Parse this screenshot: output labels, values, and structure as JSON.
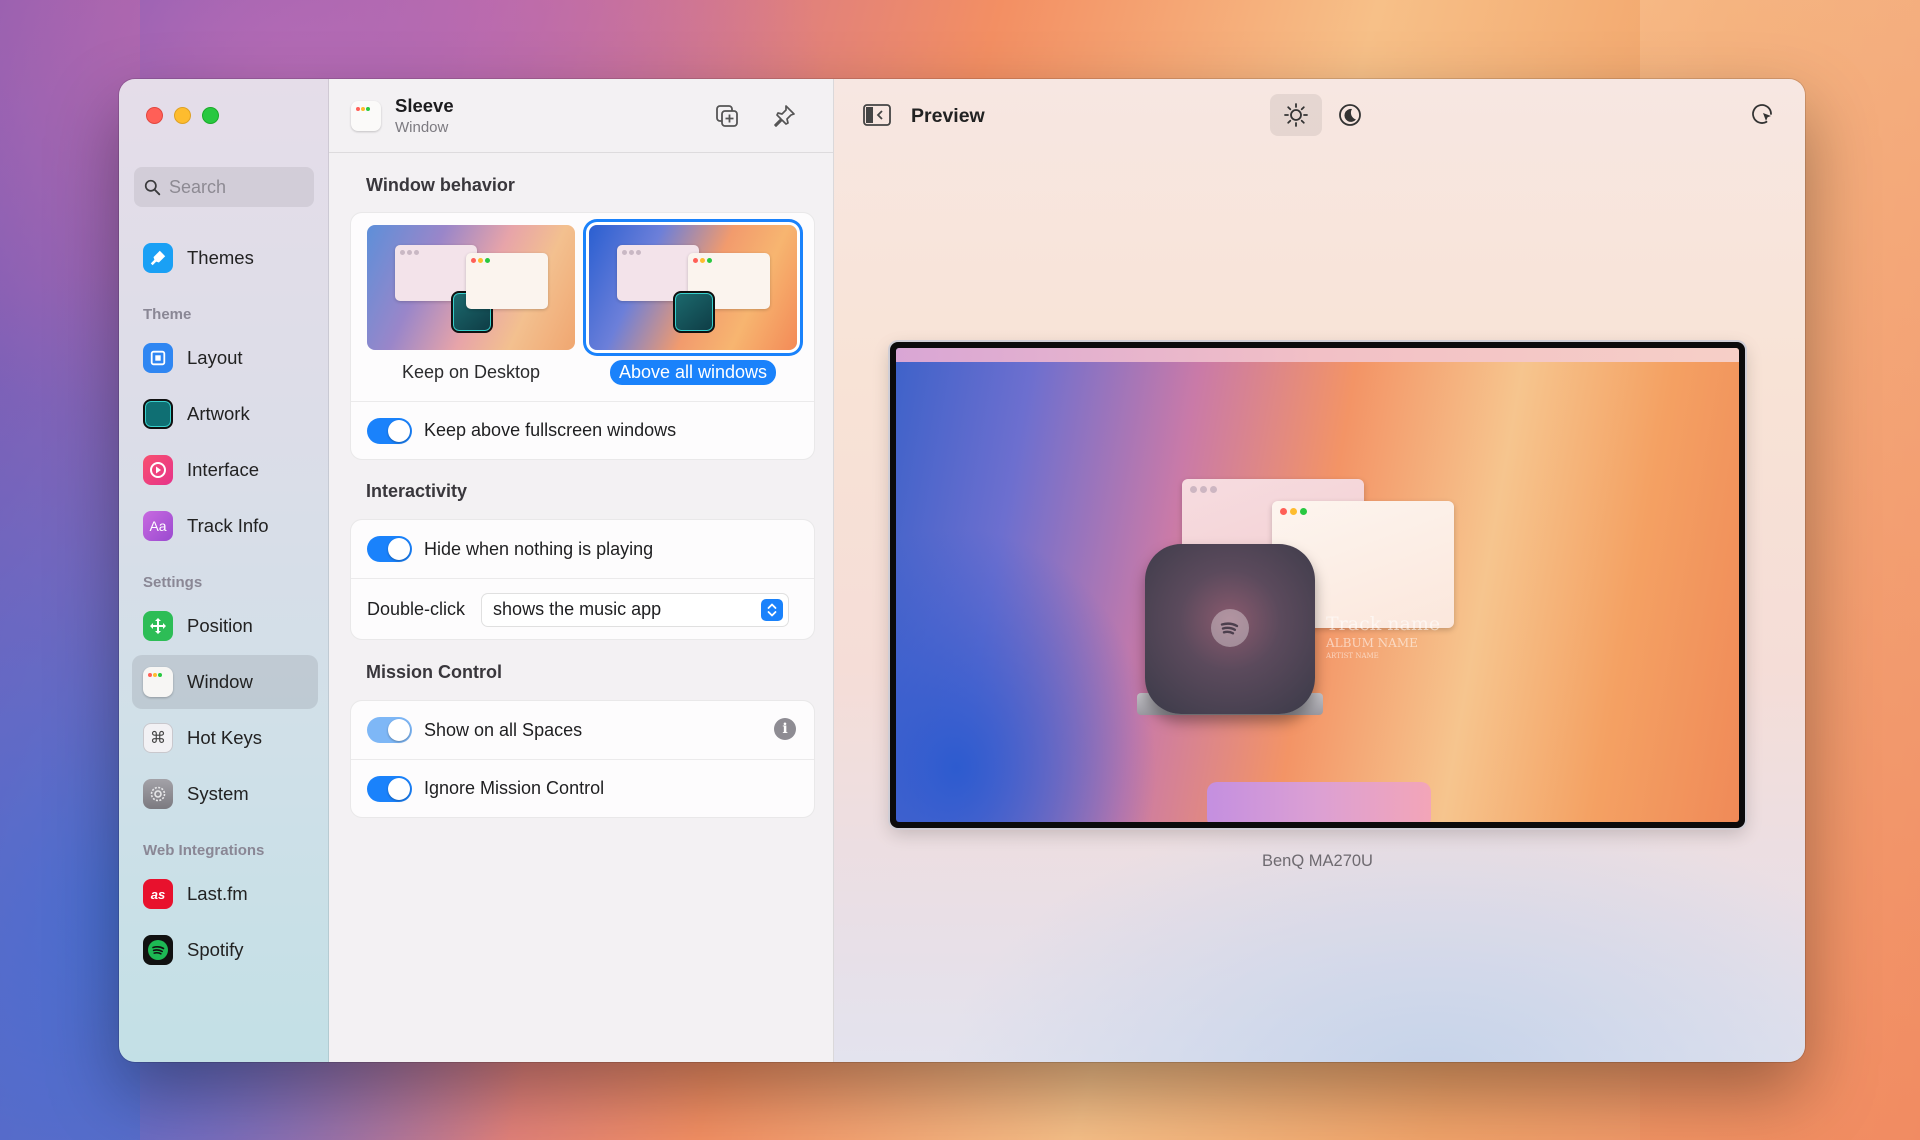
{
  "window": {
    "traffic_lights": {
      "close": "#ff5f57",
      "minimize": "#febc2e",
      "zoom": "#28c840"
    }
  },
  "sidebar": {
    "search_placeholder": "Search",
    "items": [
      {
        "label": "Themes",
        "icon": "themes-icon",
        "color": "#1aa0f5"
      },
      {
        "section": "Theme"
      },
      {
        "label": "Layout",
        "icon": "layout-icon",
        "color": "#2f86f2"
      },
      {
        "label": "Artwork",
        "icon": "artwork-icon",
        "color": "#0f6f73"
      },
      {
        "label": "Interface",
        "icon": "interface-icon",
        "color": "#f2496e"
      },
      {
        "label": "Track Info",
        "icon": "track-info-icon",
        "color": "#b45ad6"
      },
      {
        "section": "Settings"
      },
      {
        "label": "Position",
        "icon": "position-icon",
        "color": "#2dbd56"
      },
      {
        "label": "Window",
        "icon": "window-icon",
        "color": "#f4f3f1",
        "active": true
      },
      {
        "label": "Hot Keys",
        "icon": "hot-keys-icon",
        "color": "#e9e8ec"
      },
      {
        "label": "System",
        "icon": "system-icon",
        "color": "#8e8d93"
      },
      {
        "section": "Web Integrations"
      },
      {
        "label": "Last.fm",
        "icon": "lastfm-icon",
        "color": "#e8112d"
      },
      {
        "label": "Spotify",
        "icon": "spotify-icon",
        "color": "#1db954"
      }
    ],
    "sections": {
      "theme": "Theme",
      "settings": "Settings",
      "web": "Web Integrations"
    }
  },
  "panel": {
    "app_name": "Sleeve",
    "subtitle": "Window",
    "window_behavior": {
      "label": "Window behavior",
      "options": [
        "Keep on Desktop",
        "Above all windows"
      ],
      "selected": "Above all windows",
      "keep_above_fullscreen": {
        "label": "Keep above fullscreen windows",
        "on": true
      }
    },
    "interactivity": {
      "label": "Interactivity",
      "hide_when_nothing": {
        "label": "Hide when nothing is playing",
        "on": true
      },
      "double_click": {
        "label": "Double-click",
        "value": "shows the music app"
      }
    },
    "mission_control": {
      "label": "Mission Control",
      "show_all_spaces": {
        "label": "Show on all Spaces",
        "on": true
      },
      "ignore_mission_control": {
        "label": "Ignore Mission Control",
        "on": true
      }
    }
  },
  "preview": {
    "title": "Preview",
    "appearance": "light",
    "monitor_name": "BenQ MA270U",
    "track_name": "Track name",
    "album_name": "ALBUM NAME",
    "artist_name": "ARTIST NAME"
  }
}
